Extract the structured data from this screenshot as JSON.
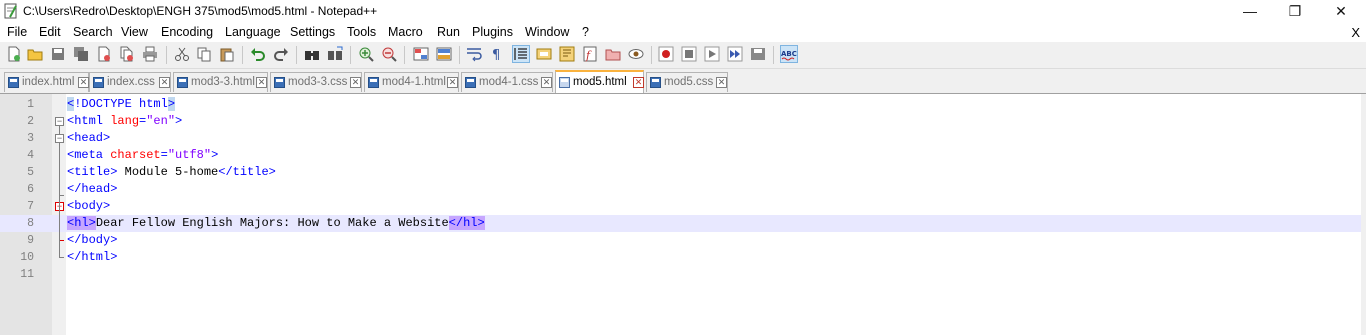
{
  "window": {
    "title": "C:\\Users\\Redro\\Desktop\\ENGH 375\\mod5\\mod5.html - Notepad++",
    "minimize": "—",
    "maximize": "❐",
    "close": "✕"
  },
  "menu": {
    "items": [
      "File",
      "Edit",
      "Search",
      "View",
      "Encoding",
      "Language",
      "Settings",
      "Tools",
      "Macro",
      "Run",
      "Plugins",
      "Window",
      "?"
    ],
    "close_doc": "X"
  },
  "toolbar": {
    "icons": [
      "new-file",
      "open-file",
      "save",
      "save-all",
      "close",
      "close-all",
      "print",
      "cut",
      "copy",
      "paste",
      "undo",
      "redo",
      "find",
      "replace",
      "zoom-in",
      "zoom-out",
      "sync-v",
      "sync-h",
      "word-wrap",
      "show-all-chars",
      "indent-guide",
      "user-define",
      "doc-map",
      "function-list",
      "folder-as-workspace",
      "monitoring",
      "record-macro",
      "stop-macro",
      "play-macro",
      "run-macro-multiple",
      "save-macro",
      "spell-check"
    ]
  },
  "tabs": [
    {
      "label": "index.html",
      "active": false
    },
    {
      "label": "index.css",
      "active": false
    },
    {
      "label": "mod3-3.html",
      "active": false
    },
    {
      "label": "mod3-3.css",
      "active": false
    },
    {
      "label": "mod4-1.html",
      "active": false
    },
    {
      "label": "mod4-1.css",
      "active": false
    },
    {
      "label": "mod5.html",
      "active": true
    },
    {
      "label": "mod5.css",
      "active": false
    }
  ],
  "editor": {
    "current_line": 8,
    "lines": [
      {
        "n": "1",
        "parts": [
          [
            "tag hl-blue",
            "<"
          ],
          [
            "tag",
            "!DOCTYPE html"
          ],
          [
            "tag hl-blue",
            ">"
          ]
        ]
      },
      {
        "n": "2",
        "parts": [
          [
            "tag",
            "<html "
          ],
          [
            "attr",
            "lang"
          ],
          [
            "tag",
            "="
          ],
          [
            "val",
            "\"en\""
          ],
          [
            "tag",
            ">"
          ]
        ]
      },
      {
        "n": "3",
        "parts": [
          [
            "tag",
            "<head>"
          ]
        ]
      },
      {
        "n": "4",
        "parts": [
          [
            "tag",
            "<meta "
          ],
          [
            "attr",
            "charset"
          ],
          [
            "tag",
            "="
          ],
          [
            "val",
            "\"utf8\""
          ],
          [
            "tag",
            ">"
          ]
        ]
      },
      {
        "n": "5",
        "parts": [
          [
            "tag",
            "<title>"
          ],
          [
            "txt",
            " Module 5-home"
          ],
          [
            "tag",
            "</title>"
          ]
        ]
      },
      {
        "n": "6",
        "parts": [
          [
            "tag",
            "</head>"
          ]
        ]
      },
      {
        "n": "7",
        "parts": [
          [
            "tag",
            "<body>"
          ]
        ]
      },
      {
        "n": "8",
        "parts": [
          [
            "tag hl-purple",
            "<hl>"
          ],
          [
            "txt",
            "Dear Fellow English Majors: How to Make a Website"
          ],
          [
            "tag hl-purple",
            "</hl>"
          ]
        ]
      },
      {
        "n": "9",
        "parts": [
          [
            "tag",
            "</body>"
          ]
        ]
      },
      {
        "n": "10",
        "parts": [
          [
            "tag",
            "</html>"
          ]
        ]
      },
      {
        "n": "11",
        "parts": []
      }
    ]
  },
  "colors": {
    "tag": "#0000ff",
    "attribute": "#ff0000",
    "value": "#8000ff",
    "current_line": "#e8e8ff",
    "active_tab_accent": "#fab23e"
  }
}
